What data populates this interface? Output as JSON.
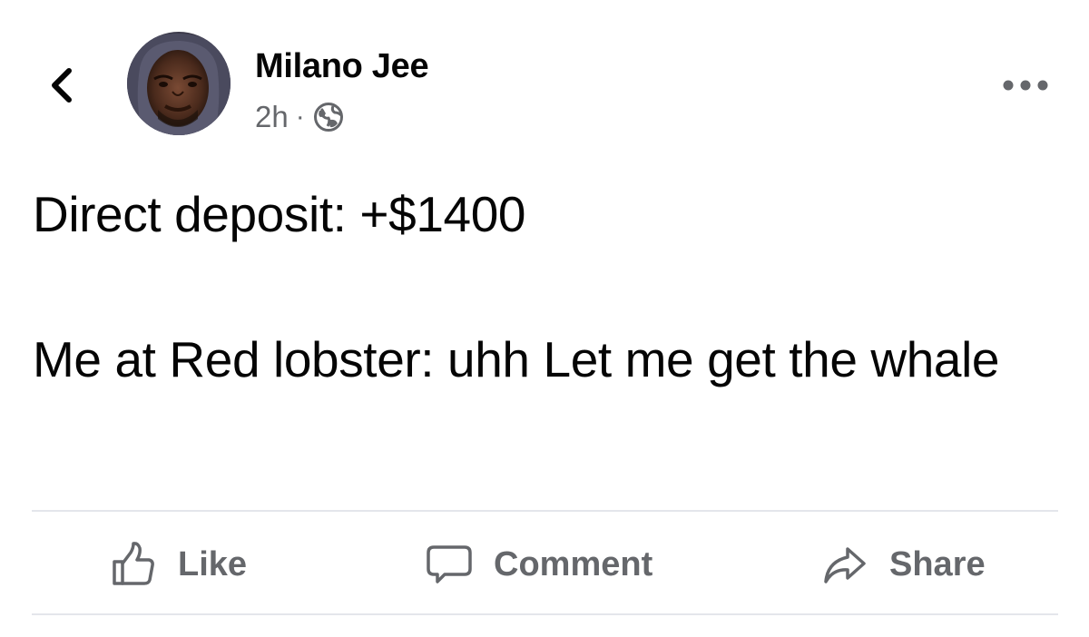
{
  "post": {
    "author": "Milano Jee",
    "time": "2h",
    "separator": "·",
    "audience_icon": "globe-icon",
    "lines": [
      "Direct deposit: +$1400",
      "Me at Red lobster: uhh Let me get the whale"
    ]
  },
  "header": {
    "back_icon": "chevron-left-icon",
    "more_icon": "more-options-icon"
  },
  "actions": {
    "like": "Like",
    "comment": "Comment",
    "share": "Share"
  },
  "colors": {
    "text": "#050505",
    "secondary_text": "#65676b",
    "divider": "#e4e6eb",
    "background": "#ffffff"
  }
}
